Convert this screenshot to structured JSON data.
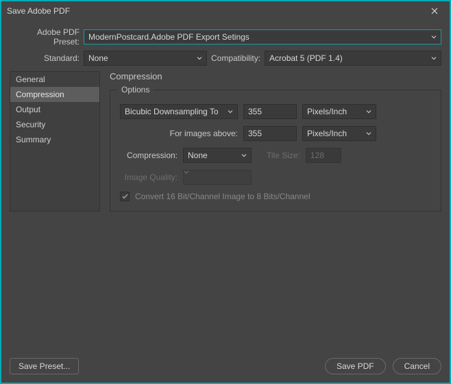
{
  "title": "Save Adobe PDF",
  "labels": {
    "preset": "Adobe PDF Preset:",
    "standard": "Standard:",
    "compatibility": "Compatibility:"
  },
  "preset": {
    "value": "ModernPostcard.Adobe PDF Export Setings"
  },
  "standard": {
    "value": "None"
  },
  "compatibility": {
    "value": "Acrobat 5 (PDF 1.4)"
  },
  "sidebar": {
    "items": [
      {
        "label": "General"
      },
      {
        "label": "Compression"
      },
      {
        "label": "Output"
      },
      {
        "label": "Security"
      },
      {
        "label": "Summary"
      }
    ],
    "selected": 1
  },
  "section": {
    "title": "Compression"
  },
  "options": {
    "legend": "Options",
    "downsample_method": "Bicubic Downsampling To",
    "downsample_value": "355",
    "downsample_unit": "Pixels/Inch",
    "above_label": "For images above:",
    "above_value": "355",
    "above_unit": "Pixels/Inch",
    "compression_label": "Compression:",
    "compression_value": "None",
    "tile_label": "Tile Size:",
    "tile_value": "128",
    "image_quality_label": "Image Quality:",
    "convert_label": "Convert 16 Bit/Channel Image to 8 Bits/Channel"
  },
  "buttons": {
    "save_preset": "Save Preset...",
    "save_pdf": "Save PDF",
    "cancel": "Cancel"
  }
}
